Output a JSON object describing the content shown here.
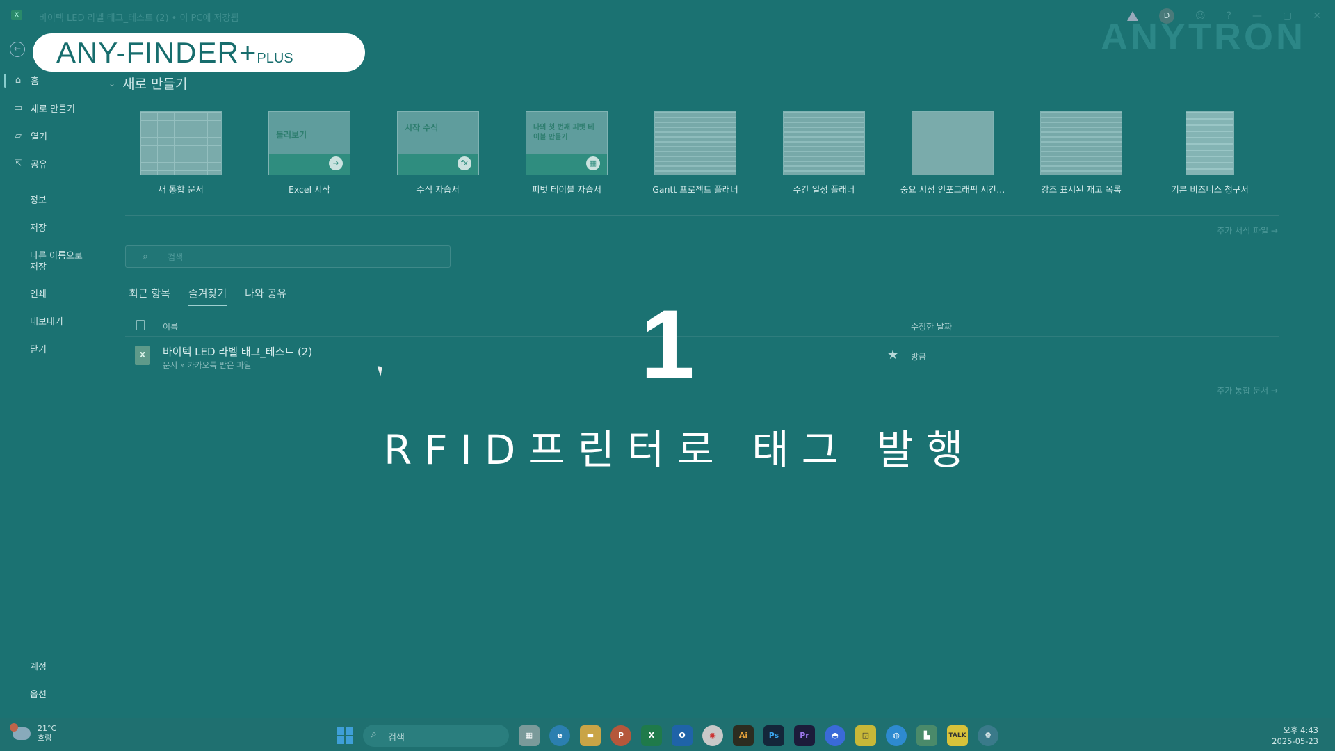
{
  "window": {
    "title": "바이텍 LED 라벨 태그_테스트 (2) • 이 PC에 저장됨",
    "app_badge": "X",
    "user_initial": "D"
  },
  "overlay": {
    "logo_main": "ANY-FINDER+",
    "logo_plus": "PLUS",
    "brand_watermark": "ANYTRON",
    "step_number": "1",
    "caption": "RFID프린터로 태그 발행"
  },
  "sidebar": {
    "back_icon": "back-arrow-icon",
    "items": [
      {
        "label": "홈",
        "icon": "home-icon"
      },
      {
        "label": "새로 만들기",
        "icon": "new-file-icon"
      },
      {
        "label": "열기",
        "icon": "folder-open-icon"
      },
      {
        "label": "공유",
        "icon": "share-icon"
      }
    ],
    "sub_items": [
      "정보",
      "저장",
      "다른 이름으로 저장",
      "인쇄",
      "내보내기",
      "닫기"
    ],
    "bottom_items": [
      "계정",
      "옵션"
    ]
  },
  "new_section": {
    "title": "새로 만들기",
    "templates": [
      {
        "name": "새 통합 문서"
      },
      {
        "name": "Excel 시작",
        "thumb_text": "둘러보기"
      },
      {
        "name": "수식 자습서",
        "thumb_text": "시작 수식"
      },
      {
        "name": "피벗 테이블 자습서",
        "thumb_text": "나의 첫 번째 피벗 테이블 만들기"
      },
      {
        "name": "Gantt 프로젝트 플래너"
      },
      {
        "name": "주간 일정 플래너"
      },
      {
        "name": "중요 시점 인포그래픽 시간..."
      },
      {
        "name": "강조 표시된 재고 목록"
      },
      {
        "name": "기본 비즈니스 청구서"
      }
    ],
    "more_templates": "추가 서식 파일 →"
  },
  "search": {
    "placeholder": "검색"
  },
  "tabs": [
    {
      "label": "최근 항목",
      "active": false
    },
    {
      "label": "즐겨찾기",
      "active": true
    },
    {
      "label": "나와 공유",
      "active": false
    }
  ],
  "file_list": {
    "headers": {
      "name": "이름",
      "modified": "수정한 날짜"
    },
    "rows": [
      {
        "name": "바이텍 LED 라벨 태그_테스트 (2)",
        "path": "문서 » 카카오톡 받은 파일",
        "modified": "방금",
        "favorite": true
      }
    ],
    "more_workbooks": "추가 통합 문서 →"
  },
  "taskbar": {
    "weather_temp": "21°C",
    "weather_desc": "흐림",
    "search_label": "검색",
    "apps": [
      "file-explorer",
      "edge",
      "folder",
      "powerpoint",
      "excel",
      "outlook",
      "chrome",
      "illustrator",
      "photoshop",
      "premiere",
      "messenger",
      "sticky-notes",
      "browser",
      "app",
      "kakaotalk",
      "settings"
    ],
    "time": "오후 4:43",
    "date": "2025-05-23"
  }
}
